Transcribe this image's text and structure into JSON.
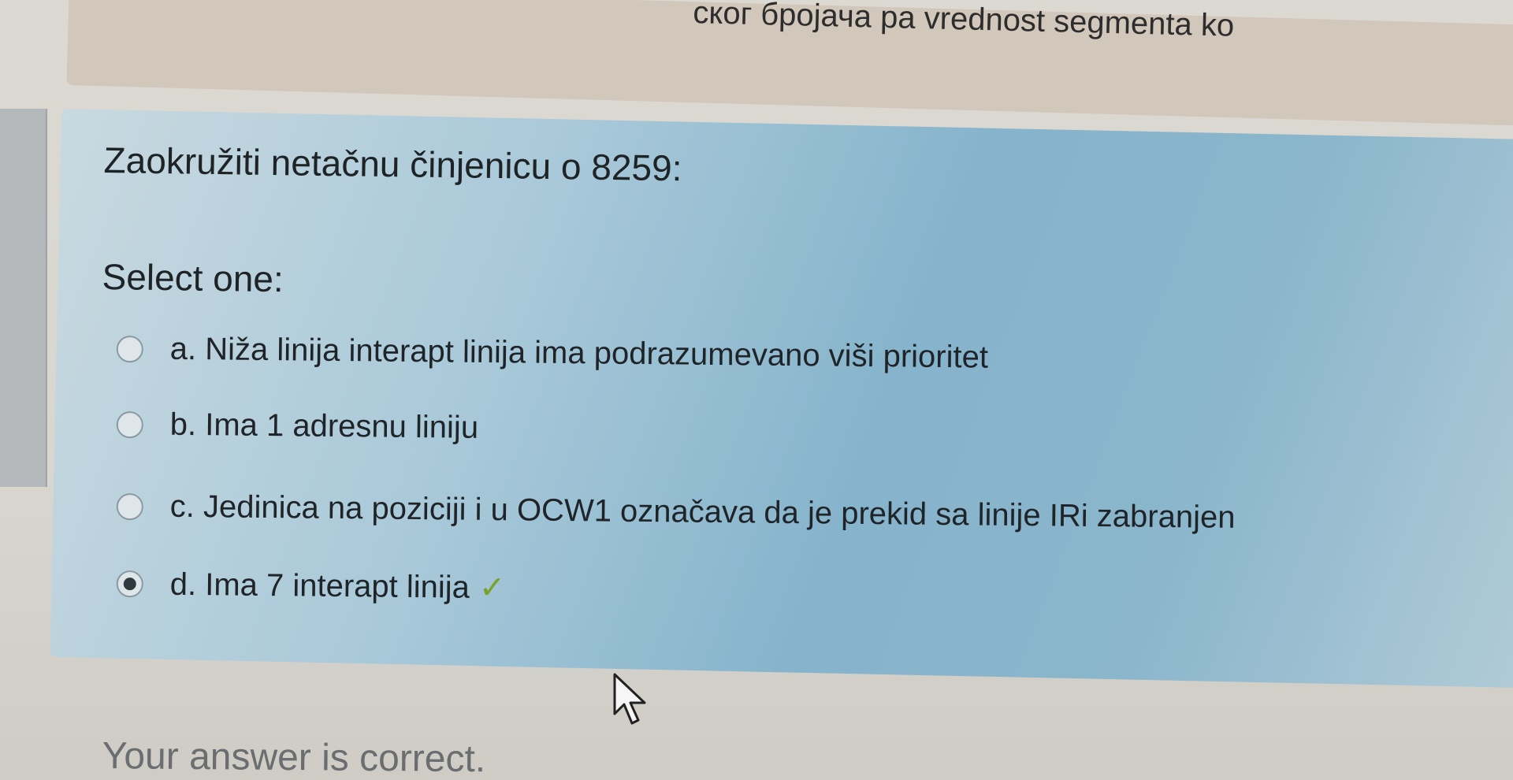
{
  "header": {
    "partial_text": "ског бројача pa vrednost segmenta ko"
  },
  "question": {
    "text": "Zaokružiti netačnu činjenicu o 8259:",
    "prompt": "Select one:",
    "options": [
      {
        "label": "a. Niža linija interapt linija ima podrazumevano viši prioritet",
        "selected": false,
        "correct": false
      },
      {
        "label": "b. Ima 1 adresnu liniju",
        "selected": false,
        "correct": false
      },
      {
        "label": "c. Jedinica na poziciji i u OCW1 označava da je prekid sa linije IRi zabranjen",
        "selected": false,
        "correct": false
      },
      {
        "label": "d. Ima 7 interapt linija",
        "selected": true,
        "correct": true
      }
    ],
    "check_mark": "✓"
  },
  "feedback": {
    "text": "Your answer is correct."
  },
  "colors": {
    "panel": "#8bb6cc",
    "correct_check": "#7aa12a"
  },
  "icons": {
    "cursor": "mouse-pointer-icon",
    "check": "checkmark-icon"
  }
}
